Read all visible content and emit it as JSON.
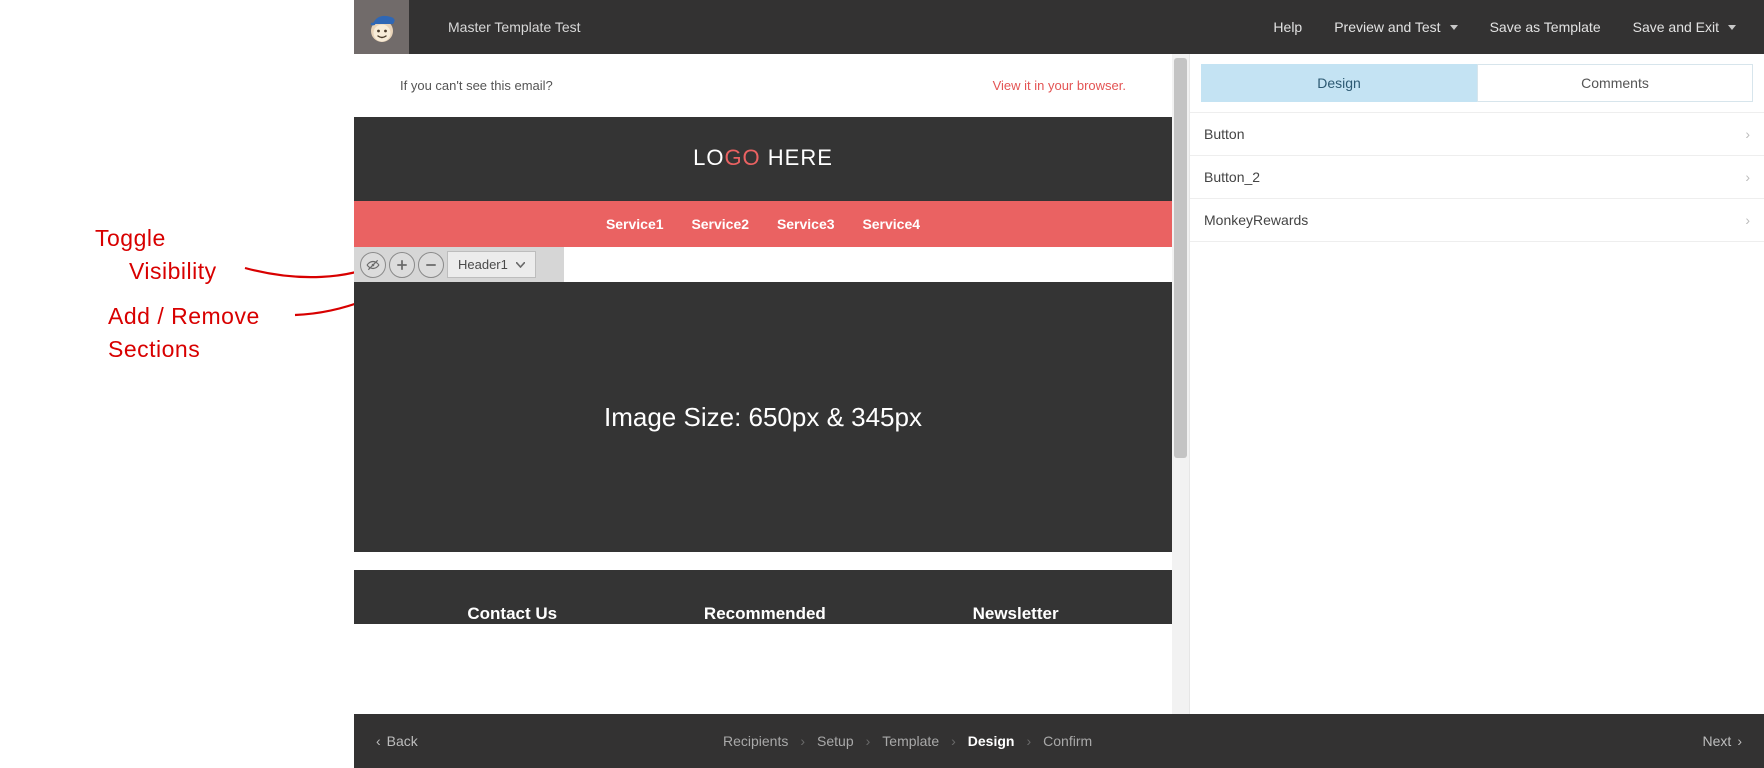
{
  "annotations": {
    "toggle": "Toggle\nVisibility",
    "add_remove": "Add / Remove\nSections"
  },
  "topbar": {
    "title": "Master Template Test",
    "help": "Help",
    "preview": "Preview and Test",
    "save_template": "Save as Template",
    "save_exit": "Save and Exit"
  },
  "email": {
    "preheader_left": "If you can't see this email?",
    "preheader_right": "View it in your browser.",
    "logo_prefix": "LO",
    "logo_mid": "GO",
    "logo_suffix": " HERE",
    "services": [
      "Service1",
      "Service2",
      "Service3",
      "Service4"
    ],
    "section_selector": "Header1",
    "hero_text": "Image Size: 650px & 345px",
    "footer_cols": [
      "Contact Us",
      "Recommended",
      "Newsletter"
    ]
  },
  "sidebar": {
    "tabs": {
      "design": "Design",
      "comments": "Comments"
    },
    "items": [
      {
        "label": "Button"
      },
      {
        "label": "Button_2"
      },
      {
        "label": "MonkeyRewards"
      }
    ]
  },
  "bottombar": {
    "back": "Back",
    "steps": [
      "Recipients",
      "Setup",
      "Template",
      "Design",
      "Confirm"
    ],
    "active_step_index": 3,
    "next": "Next"
  }
}
